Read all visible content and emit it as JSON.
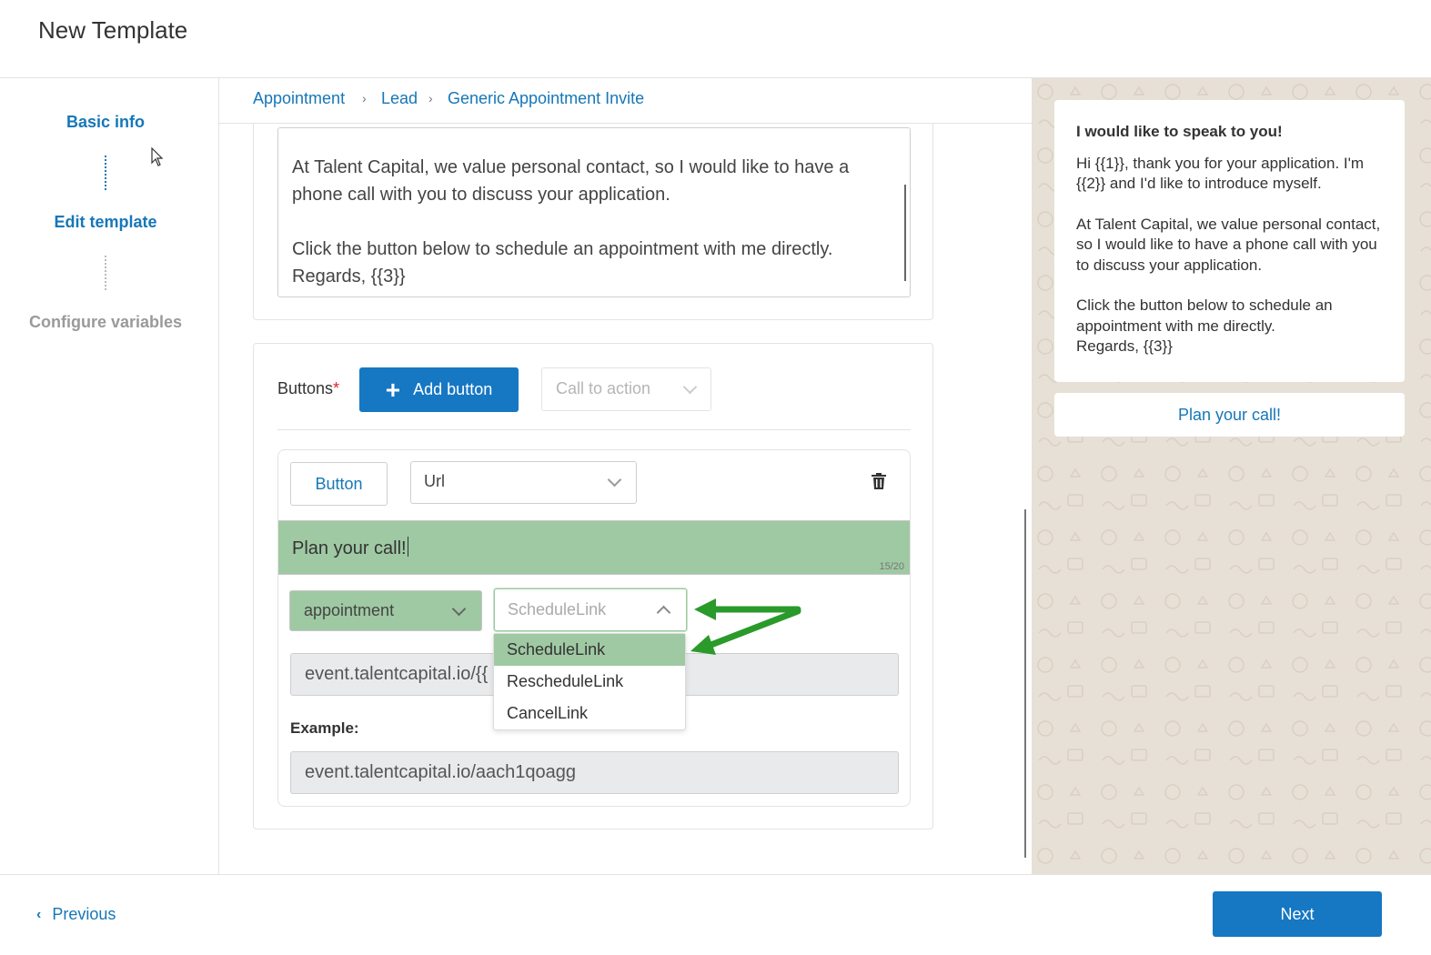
{
  "header": {
    "title": "New Template"
  },
  "steps": [
    {
      "label": "Basic info",
      "state": "active"
    },
    {
      "label": "Edit template",
      "state": "active"
    },
    {
      "label": "Configure variables",
      "state": "inactive"
    }
  ],
  "breadcrumb": [
    "Appointment",
    "Lead",
    "Generic Appointment Invite"
  ],
  "body_text": {
    "line1": "At Talent Capital, we value personal contact, so I would like to have a phone call with you to discuss your application.",
    "line2": "Click the button below to schedule an appointment with me directly.\nRegards, {{3}}"
  },
  "buttons_section": {
    "label": "Buttons",
    "required_mark": "*",
    "add_button_label": "Add button",
    "type_select_placeholder": "Call to action",
    "button_item": {
      "type_button_label": "Button",
      "url_select_value": "Url",
      "button_text": "Plan your call!",
      "char_counter": "15/20",
      "category_select_value": "appointment",
      "link_select_placeholder": "ScheduleLink",
      "url_value": "event.talentcapital.io/{{",
      "example_label": "Example:",
      "example_value": "event.talentcapital.io/aach1qoagg"
    }
  },
  "dropdown": {
    "options": [
      "ScheduleLink",
      "RescheduleLink",
      "CancelLink"
    ],
    "highlighted": "ScheduleLink"
  },
  "preview": {
    "title": "I would like to speak to you!",
    "para1": "Hi {{1}}, thank you for your application. I'm {{2}} and I'd like to introduce myself.",
    "para2": "At Talent Capital, we value personal contact, so I would like to have a phone call with you to discuss your application.",
    "para3": "Click the button below to schedule an appointment with me directly.\nRegards, {{3}}",
    "button_label": "Plan your call!"
  },
  "footer": {
    "previous_label": "Previous",
    "next_label": "Next"
  },
  "colors": {
    "accent": "#1677c3",
    "highlight_green": "#9fc9a3",
    "arrow_green": "#2a9a2a",
    "preview_bg": "#e7e0d6"
  }
}
